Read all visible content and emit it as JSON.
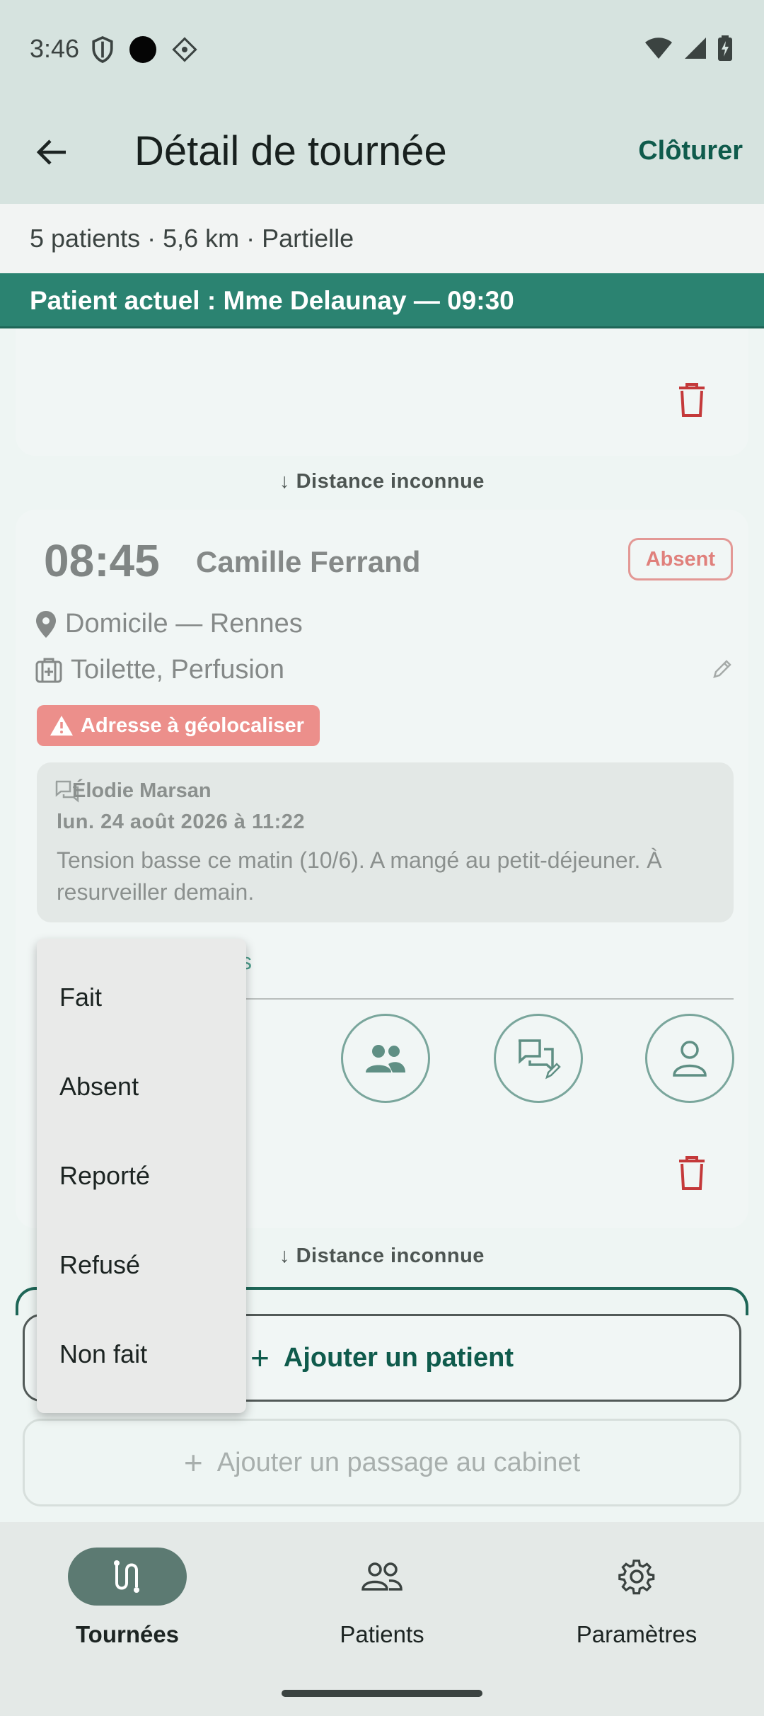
{
  "status_bar": {
    "time": "3:46"
  },
  "app_bar": {
    "title": "Détail de tournée",
    "action_label": "Clôturer"
  },
  "summary": {
    "text": "5 patients · 5,6 km · Partielle"
  },
  "current_patient": {
    "text": "Patient actuel : Mme Delaunay — 09:30"
  },
  "distance_label": "Distance inconnue",
  "distance_arrow": "↓",
  "visit": {
    "time": "08:45",
    "patient_name": "Camille Ferrand",
    "status": "Absent",
    "location": "Domicile — Rennes",
    "care": "Toilette, Perfusion",
    "warning": "Adresse à géolocaliser",
    "note": {
      "author": "Élodie Marsan",
      "date": "lun. 24 août 2026 à 11:22",
      "text": "Tension basse ce matin (10/6). A mangé au petit-déjeuner. À resurveiller demain."
    },
    "hidden_field_fragment": "s"
  },
  "status_menu": {
    "options": [
      "Fait",
      "Absent",
      "Reporté",
      "Refusé",
      "Non fait"
    ]
  },
  "actions": {
    "add_patient": "Ajouter un patient",
    "add_cabinet": "Ajouter un passage au cabinet",
    "plus": "+"
  },
  "bottom_nav": {
    "items": [
      {
        "label": "Tournées",
        "active": true
      },
      {
        "label": "Patients",
        "active": false
      },
      {
        "label": "Paramètres",
        "active": false
      }
    ]
  },
  "colors": {
    "primary": "#0f5b4c",
    "banner": "#2b8371",
    "danger": "#c4393a",
    "warning_badge": "#ec8f8b",
    "nav_active": "#5c7a72"
  },
  "icons": {
    "status_left": [
      "shield-icon",
      "camera-dot-icon",
      "vpn-diamond-icon"
    ],
    "status_right": [
      "wifi-icon",
      "signal-icon",
      "battery-icon"
    ],
    "card": [
      "location-pin-icon",
      "medical-bag-icon",
      "edit-pencil-icon",
      "warning-icon",
      "chat-icon",
      "trash-icon"
    ],
    "round_buttons": [
      "group-icon",
      "chat-edit-icon",
      "person-icon"
    ],
    "nav": [
      "route-icon",
      "people-icon",
      "gear-icon"
    ]
  }
}
